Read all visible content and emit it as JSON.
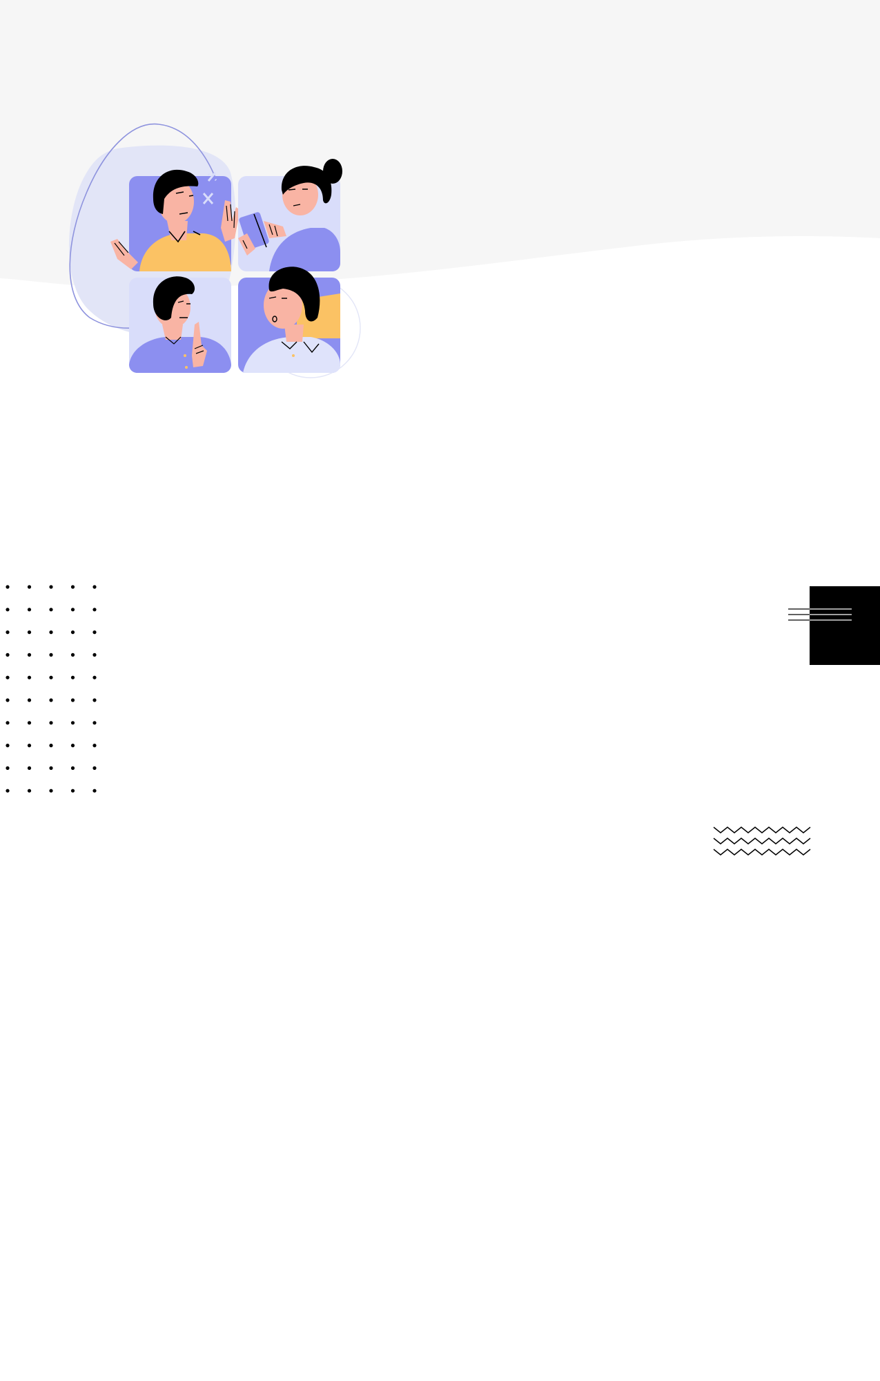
{
  "colors": {
    "background": "#ffffff",
    "header_band": "#f6f6f6",
    "blob_light": "#e2e5f7",
    "outline_purple": "#8e93de",
    "panel_purple": "#8c8ff0",
    "panel_light": "#d9ddfa",
    "skin": "#f9b4a4",
    "hair": "#000000",
    "shirt_yellow": "#fbc264",
    "shirt_purple": "#8c8ff0",
    "shirt_light": "#dfe3fb",
    "ink": "#000000"
  },
  "illustration": {
    "name": "video-call-group",
    "participants": [
      {
        "name": "man-waving",
        "shirt": "yellow"
      },
      {
        "name": "woman-with-phone",
        "shirt": "purple"
      },
      {
        "name": "man-thinking",
        "shirt": "purple"
      },
      {
        "name": "man-wondering",
        "shirt": "light"
      }
    ]
  },
  "decorations": {
    "dot_grid": {
      "rows": 10,
      "columns": 5
    },
    "stripe_lines": {
      "count": 3
    },
    "zigzag_lines": {
      "count": 3
    }
  }
}
